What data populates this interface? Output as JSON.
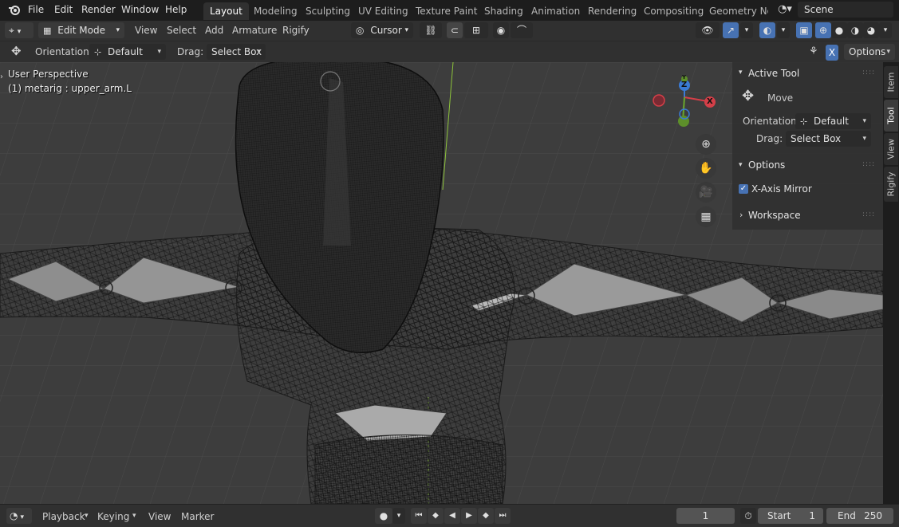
{
  "top_menu": {
    "file": "File",
    "edit": "Edit",
    "render": "Render",
    "window": "Window",
    "help": "Help"
  },
  "workspace_tabs": [
    {
      "label": "Layout",
      "active": true
    },
    {
      "label": "Modeling"
    },
    {
      "label": "Sculpting"
    },
    {
      "label": "UV Editing"
    },
    {
      "label": "Texture Paint"
    },
    {
      "label": "Shading"
    },
    {
      "label": "Animation"
    },
    {
      "label": "Rendering"
    },
    {
      "label": "Compositing"
    },
    {
      "label": "Geometry Noc"
    }
  ],
  "scene": {
    "name": "Scene"
  },
  "header": {
    "mode": "Edit Mode",
    "view": "View",
    "select": "Select",
    "add": "Add",
    "armature": "Armature",
    "rigify": "Rigify",
    "pivot": "Cursor"
  },
  "tool_header": {
    "orientation_label": "Orientation:",
    "orientation_value": "Default",
    "drag_label": "Drag:",
    "drag_value": "Select Box",
    "x_toggle": "X",
    "options": "Options"
  },
  "viewport": {
    "perspective": "User Perspective",
    "active_object": "(1) metarig : upper_arm.L",
    "gizmo": {
      "z": "Z",
      "y": "Y",
      "x": "X"
    }
  },
  "n_panel": {
    "active_tool": "Active Tool",
    "tool_name": "Move",
    "orientation_label": "Orientation",
    "orientation_value": "Default",
    "drag_label": "Drag:",
    "drag_value": "Select Box",
    "options": "Options",
    "x_axis_mirror": "X-Axis Mirror",
    "x_axis_mirror_checked": true,
    "workspace": "Workspace"
  },
  "side_tabs": [
    "Item",
    "Tool",
    "View",
    "Rigify"
  ],
  "timeline": {
    "playback": "Playback",
    "keying": "Keying",
    "view": "View",
    "marker": "Marker",
    "current_frame": "1",
    "start_label": "Start",
    "start_value": "1",
    "end_label": "End",
    "end_value": "250"
  },
  "colors": {
    "accent": "#4772b3",
    "background": "#3d3d3d",
    "panel": "#303030"
  }
}
